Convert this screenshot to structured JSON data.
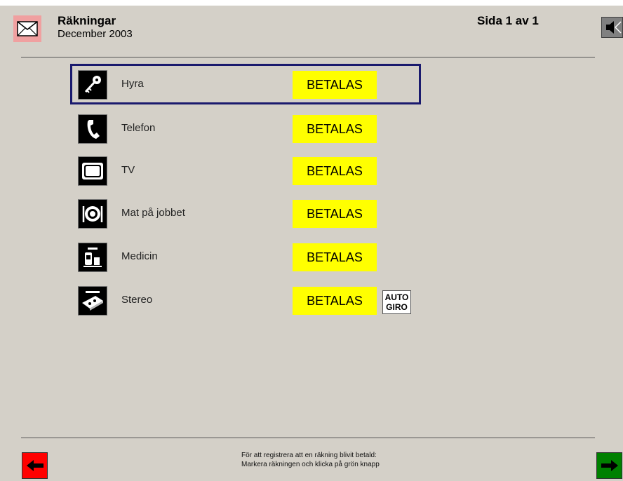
{
  "header": {
    "title": "Räkningar",
    "subtitle": "December 2003",
    "page_info": "Sida 1 av 1"
  },
  "bills": [
    {
      "label": "Hyra",
      "action": "BETALAS",
      "icon": "key-icon",
      "selected": true
    },
    {
      "label": "Telefon",
      "action": "BETALAS",
      "icon": "phone-icon"
    },
    {
      "label": "TV",
      "action": "BETALAS",
      "icon": "tv-icon"
    },
    {
      "label": "Mat på jobbet",
      "action": "BETALAS",
      "icon": "plate-icon"
    },
    {
      "label": "Medicin",
      "action": "BETALAS",
      "icon": "medicine-icon"
    },
    {
      "label": "Stereo",
      "action": "BETALAS",
      "icon": "stereo-icon",
      "badge": {
        "line1": "AUTO",
        "line2": "GIRO"
      }
    }
  ],
  "footer": {
    "line1": "För att registrera att en räkning blivit betald:",
    "line2": "Markera räkningen och klicka på grön knapp"
  },
  "colors": {
    "background": "#d4d0c8",
    "betala": "#ffff00",
    "selection": "#1a1a6e",
    "back_button": "#ff0000",
    "next_button": "#008000"
  }
}
